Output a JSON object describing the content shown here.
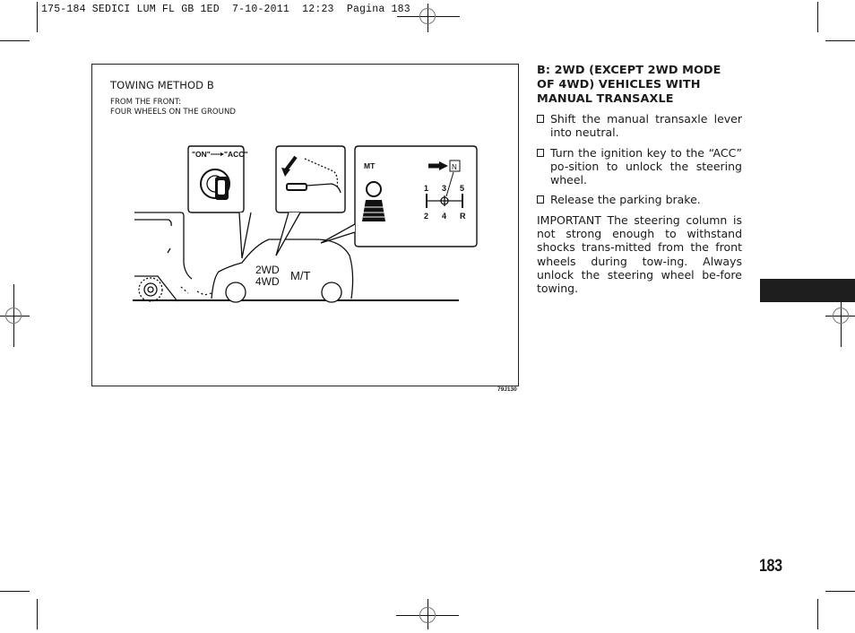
{
  "slug_line": "175-184 SEDICI LUM FL GB 1ED  7-10-2011  12:23  Pagina 183",
  "figure": {
    "title": "TOWING METHOD B",
    "subtitle_line1": "FROM THE FRONT:",
    "subtitle_line2": "FOUR WHEELS ON THE GROUND",
    "code": "79J130",
    "callouts": {
      "ignition_label_on": "\"ON\"",
      "ignition_label_acc": "\"ACC\"",
      "gear_label": "MT",
      "neutral_label": "N",
      "gear_positions_top": [
        "1",
        "3",
        "5"
      ],
      "gear_positions_bottom": [
        "2",
        "4",
        "R"
      ]
    },
    "car_labels": {
      "drive_2wd": "2WD",
      "drive_4wd": "4WD",
      "transmission": "M/T"
    }
  },
  "content": {
    "heading": "B: 2WD (EXCEPT 2WD MODE OF 4WD) VEHICLES WITH MANUAL TRANSAXLE",
    "steps": [
      "Shift the manual transaxle lever into neutral.",
      "Turn the ignition key to the “ACC” po-sition to unlock the steering wheel.",
      "Release the parking brake."
    ],
    "important_label": "IMPORTANT",
    "important_text": "The steering column is not strong enough to withstand shocks trans-mitted from the front wheels during tow-ing. Always unlock the steering wheel be-fore towing."
  },
  "page_number": "183"
}
